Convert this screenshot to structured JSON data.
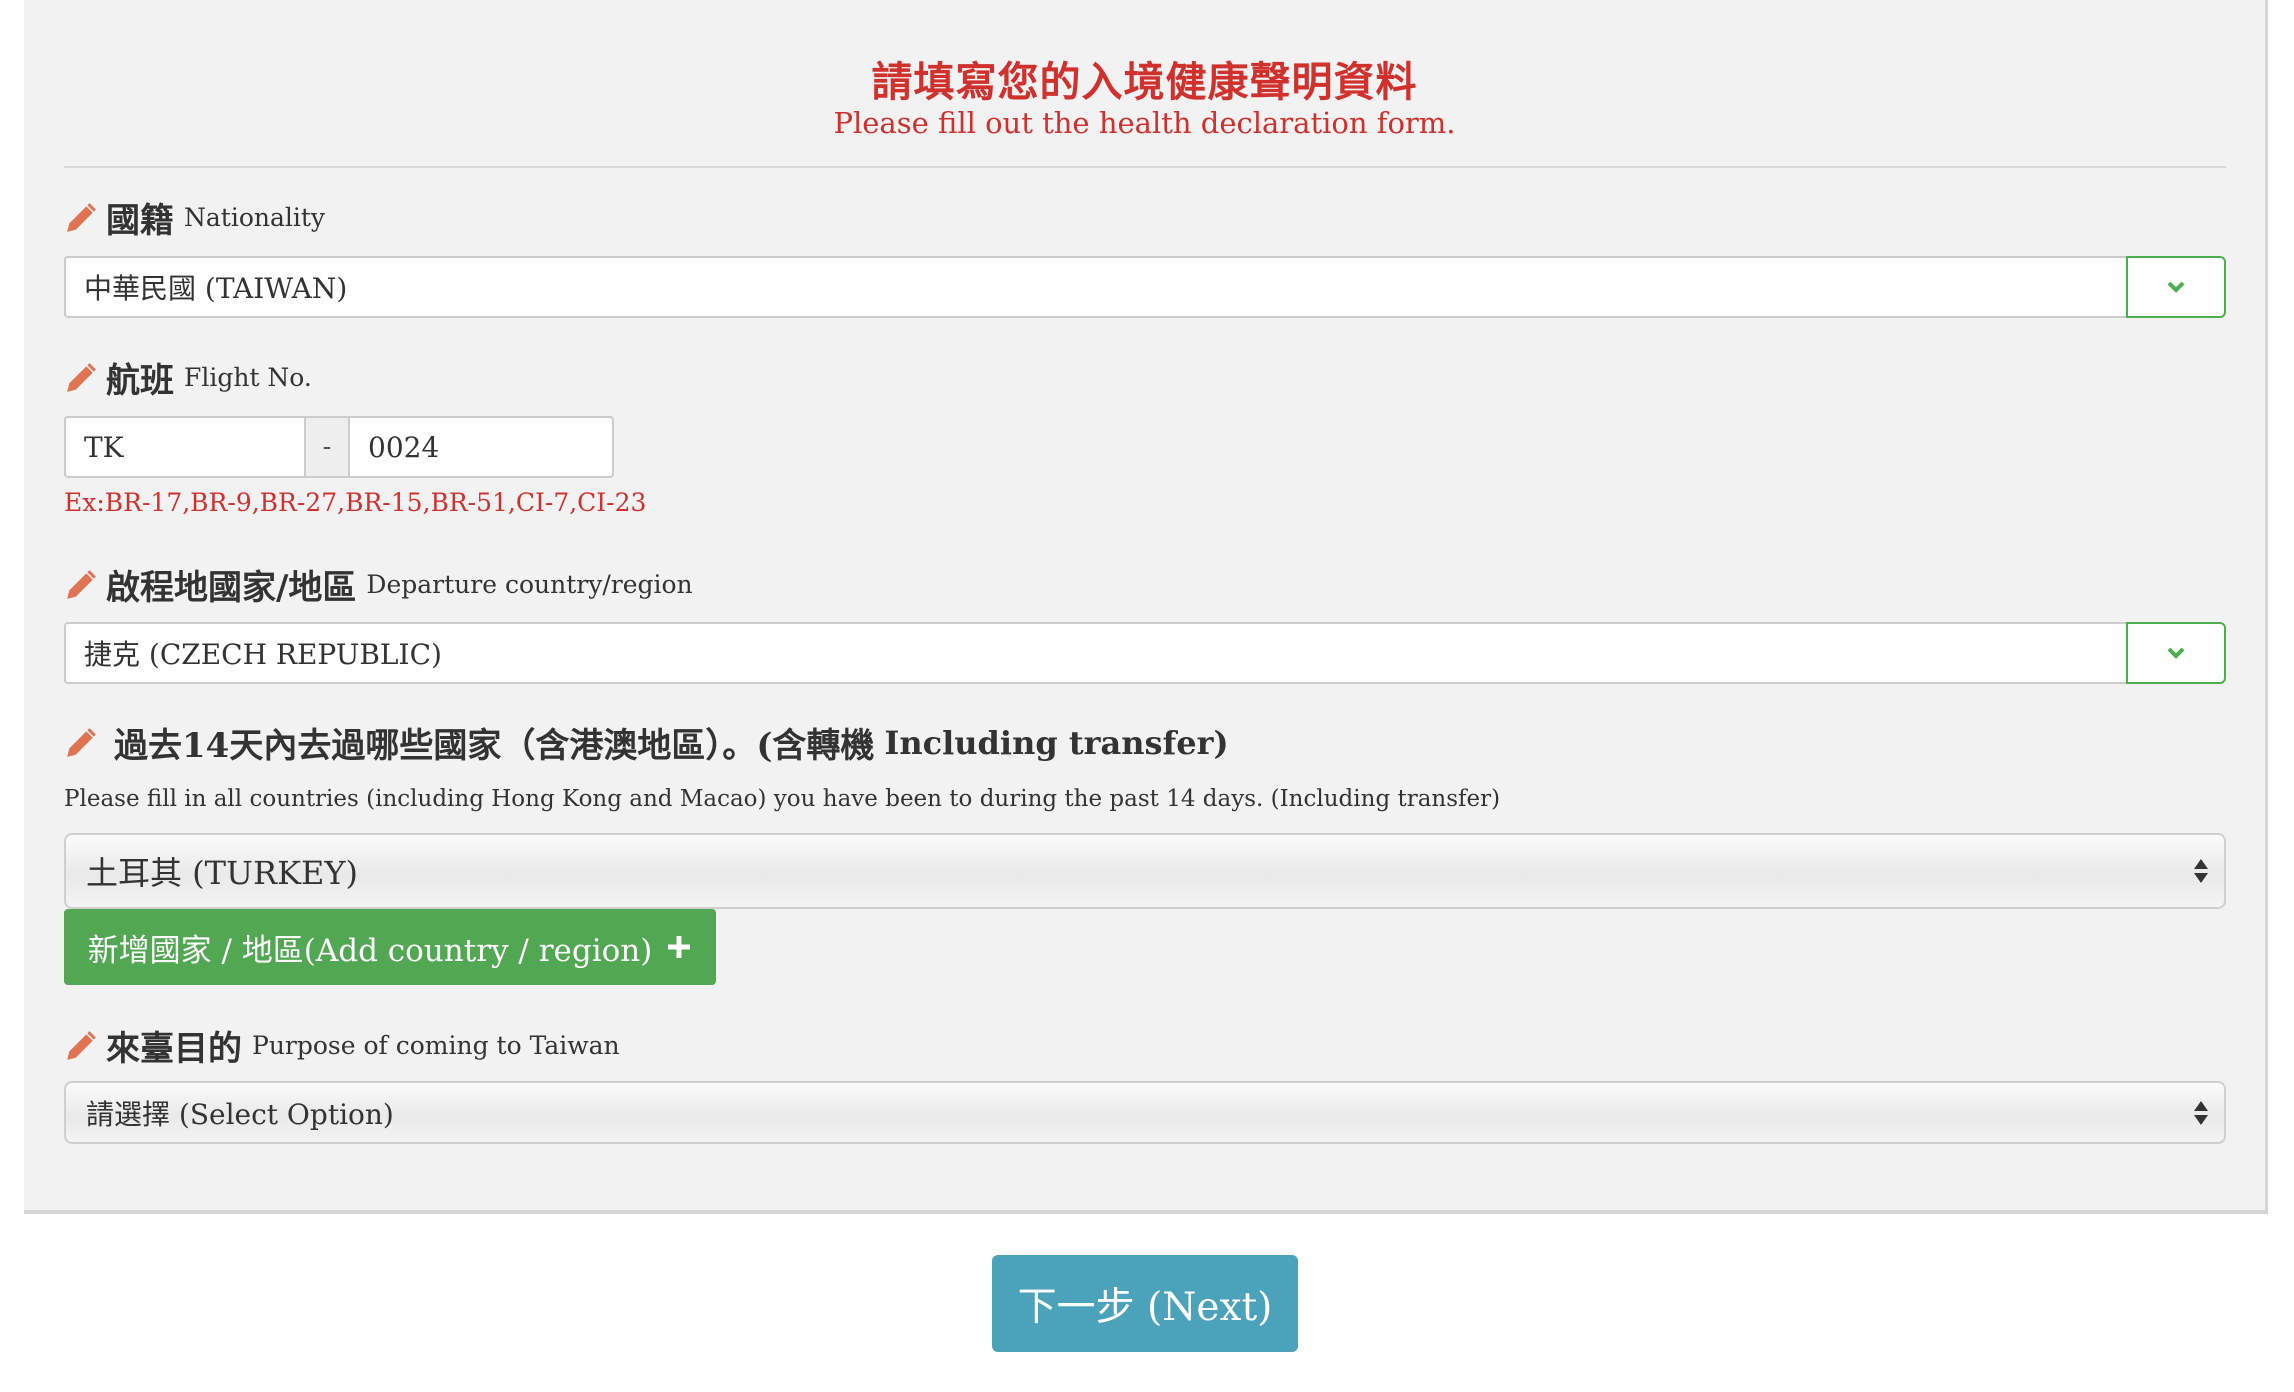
{
  "header": {
    "title": "請填寫您的入境健康聲明資料",
    "subtitle": "Please fill out the health declaration form."
  },
  "nationality": {
    "label_zh": "國籍",
    "label_en": "Nationality",
    "value": "中華民國 (TAIWAN)"
  },
  "flight": {
    "label_zh": "航班",
    "label_en": "Flight No.",
    "airline": "TK",
    "separator": "-",
    "number": "0024",
    "hint": "Ex:BR-17,BR-9,BR-27,BR-15,BR-51,CI-7,CI-23"
  },
  "departure": {
    "label_zh": "啟程地國家/地區",
    "label_en": "Departure country/region",
    "value": "捷克 (CZECH REPUBLIC)"
  },
  "visited": {
    "label_zh": "過去14天內去過哪些國家（含港澳地區）。(含轉機",
    "label_en": "Including transfer)",
    "description": "Please fill in all countries (including Hong Kong and Macao) you have been to during the past 14 days. (Including transfer)",
    "value": "土耳其 (TURKEY)",
    "add_button": "新增國家 / 地區(Add country / region)"
  },
  "purpose": {
    "label_zh": "來臺目的",
    "label_en": "Purpose of coming to Taiwan",
    "value": "請選擇 (Select Option)"
  },
  "next_button": "下一步 (Next)",
  "colors": {
    "title_red": "#d0312d",
    "pencil": "#e07352",
    "green": "#52a852",
    "teal": "#4ba3bb"
  },
  "icons": [
    "pencil-icon",
    "chevron-down-icon",
    "plus-icon",
    "select-arrows-icon"
  ]
}
